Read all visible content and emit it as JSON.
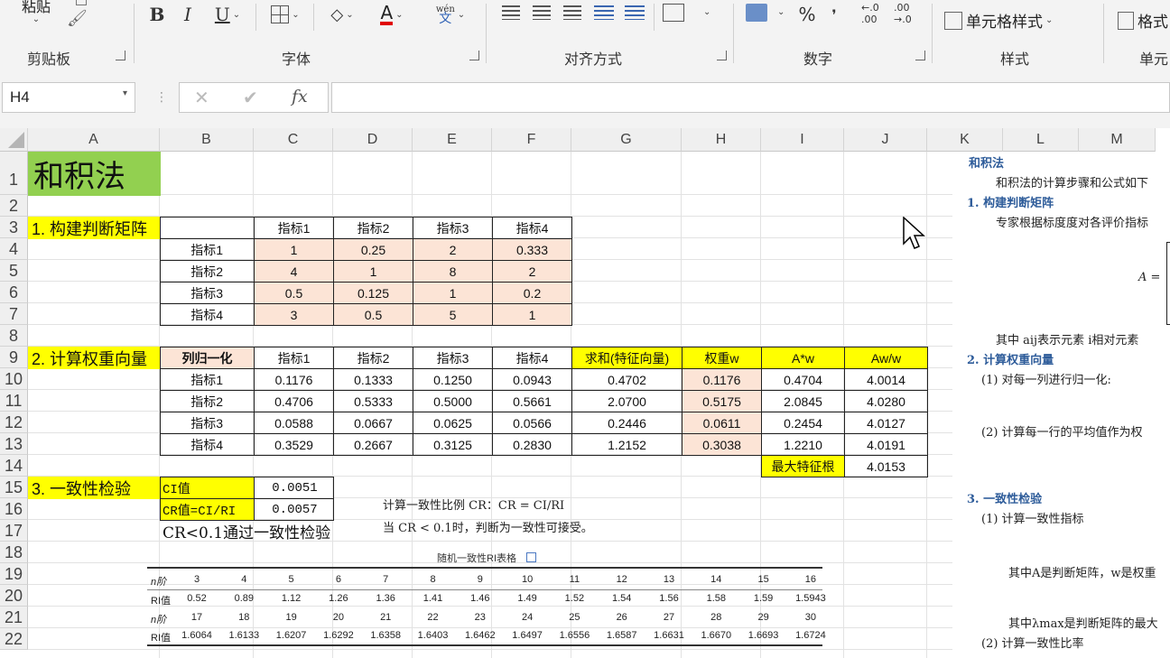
{
  "ribbon": {
    "paste_label": "粘贴",
    "groups": {
      "clipboard": "剪贴板",
      "font": "字体",
      "align": "对齐方式",
      "number": "数字",
      "styles": "样式",
      "cells": "单元"
    },
    "bold": "B",
    "italic": "I",
    "underline": "U",
    "font_color_letter": "A",
    "pinyin_top": "wén",
    "pinyin_bottom": "文",
    "percent": "%",
    "comma": "❜",
    "dec_inc": "←.0 .00",
    "dec_dec": ".00 →.0",
    "cell_style_label": "单元格样式",
    "format_label": "格式"
  },
  "formula_bar": {
    "name_box": "H4",
    "fx": "fx",
    "value": ""
  },
  "columns": [
    "A",
    "B",
    "C",
    "D",
    "E",
    "F",
    "G",
    "H",
    "I",
    "J",
    "K",
    "L",
    "M"
  ],
  "rows": [
    "1",
    "2",
    "3",
    "4",
    "5",
    "6",
    "7",
    "8",
    "9",
    "10",
    "11",
    "12",
    "13",
    "14",
    "15",
    "16",
    "17",
    "18",
    "19",
    "20",
    "21",
    "22"
  ],
  "sheet": {
    "title": "和积法",
    "sec1": "1. 构建判断矩阵",
    "sec2": "2. 计算权重向量",
    "sec3": "3. 一致性检验",
    "matrix_headers": [
      "指标1",
      "指标2",
      "指标3",
      "指标4"
    ],
    "matrix_rows": [
      {
        "label": "指标1",
        "values": [
          "1",
          "0.25",
          "2",
          "0.333"
        ]
      },
      {
        "label": "指标2",
        "values": [
          "4",
          "1",
          "8",
          "2"
        ]
      },
      {
        "label": "指标3",
        "values": [
          "0.5",
          "0.125",
          "1",
          "0.2"
        ]
      },
      {
        "label": "指标4",
        "values": [
          "3",
          "0.5",
          "5",
          "1"
        ]
      }
    ],
    "norm_corner": "列归一化",
    "norm_headers": [
      "指标1",
      "指标2",
      "指标3",
      "指标4"
    ],
    "extra_headers": [
      "求和(特征向量)",
      "权重w",
      "A*w",
      "Aw/w"
    ],
    "norm_rows": [
      {
        "label": "指标1",
        "values": [
          "0.1176",
          "0.1333",
          "0.1250",
          "0.0943"
        ],
        "sum": "0.4702",
        "w": "0.1176",
        "aw": "0.4704",
        "aww": "4.0014"
      },
      {
        "label": "指标2",
        "values": [
          "0.4706",
          "0.5333",
          "0.5000",
          "0.5661"
        ],
        "sum": "2.0700",
        "w": "0.5175",
        "aw": "2.0845",
        "aww": "4.0280"
      },
      {
        "label": "指标3",
        "values": [
          "0.0588",
          "0.0667",
          "0.0625",
          "0.0566"
        ],
        "sum": "0.2446",
        "w": "0.0611",
        "aw": "0.2454",
        "aww": "4.0127"
      },
      {
        "label": "指标4",
        "values": [
          "0.3529",
          "0.2667",
          "0.3125",
          "0.2830"
        ],
        "sum": "1.2152",
        "w": "0.3038",
        "aw": "1.2210",
        "aww": "4.0191"
      }
    ],
    "max_eig_label": "最大特征根",
    "max_eig_value": "4.0153",
    "ci_label": "CI值",
    "ci_value": "0.0051",
    "cr_label": "CR值=CI/RI",
    "cr_value": "0.0057",
    "cr_pass": "CR<0.1通过一致性检验",
    "note_line1": "计算一致性比例 CR：CR = CI/RI",
    "note_line2": "当 CR < 0.1时，判断为一致性可接受。",
    "ri_title": "随机一致性RI表格",
    "ri_row_labels": [
      "n阶",
      "RI值",
      "n阶",
      "RI值"
    ],
    "ri_n1": [
      "3",
      "4",
      "5",
      "6",
      "7",
      "8",
      "9",
      "10",
      "11",
      "12",
      "13",
      "14",
      "15",
      "16"
    ],
    "ri_v1": [
      "0.52",
      "0.89",
      "1.12",
      "1.26",
      "1.36",
      "1.41",
      "1.46",
      "1.49",
      "1.52",
      "1.54",
      "1.56",
      "1.58",
      "1.59",
      "1.5943"
    ],
    "ri_n2": [
      "17",
      "18",
      "19",
      "20",
      "21",
      "22",
      "23",
      "24",
      "25",
      "26",
      "27",
      "28",
      "29",
      "30"
    ],
    "ri_v2": [
      "1.6064",
      "1.6133",
      "1.6207",
      "1.6292",
      "1.6358",
      "1.6403",
      "1.6462",
      "1.6497",
      "1.6556",
      "1.6587",
      "1.6631",
      "1.6670",
      "1.6693",
      "1.6724"
    ]
  },
  "right_panel": {
    "title": "和积法",
    "intro": "和积法的计算步骤和公式如下",
    "step1": "1.  构建判断矩阵",
    "step1_text": "专家根据标度度对各评价指标",
    "matrix_sym": "A =",
    "aij_text": "其中 aij表示元素 i相对元素",
    "step2": "2.  计算权重向量",
    "s2_1": "(1)  对每一列进行归一化:",
    "s2_2": "(2)  计算每一行的平均值作为权",
    "step3": "3.  一致性检验",
    "s3_1": "(1)  计算一致性指标",
    "s3_a": "其中A是判断矩阵，w是权重",
    "s3_b": "其中λmax是判断矩阵的最大",
    "s3_2": "(2)  计算一致性比率"
  },
  "colors": {
    "title_green": "#92d050",
    "yellow": "#ffff00",
    "peach": "#fce4d6",
    "heading_blue": "#2e5c9a"
  }
}
